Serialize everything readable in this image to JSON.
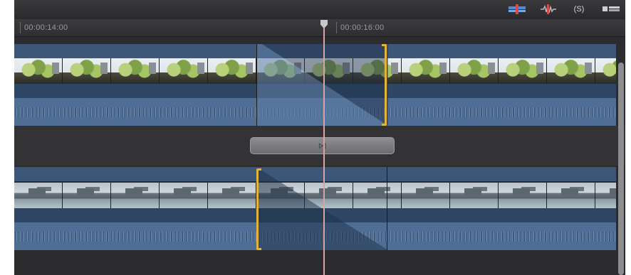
{
  "ruler": {
    "timecode_left": "00:00:14:00",
    "timecode_right": "00:00:16:00"
  },
  "toolbar": {
    "icons": [
      "video-audio-icon",
      "audio-waveform-icon",
      "solo-icon",
      "clip-appearance-icon"
    ],
    "solo_label": "(S)"
  },
  "transition": {
    "icon": "⋈"
  },
  "colors": {
    "accent_bracket": "#e2b23a",
    "clip_blue": "#4e6e96",
    "playhead": "#d7a6a0"
  }
}
